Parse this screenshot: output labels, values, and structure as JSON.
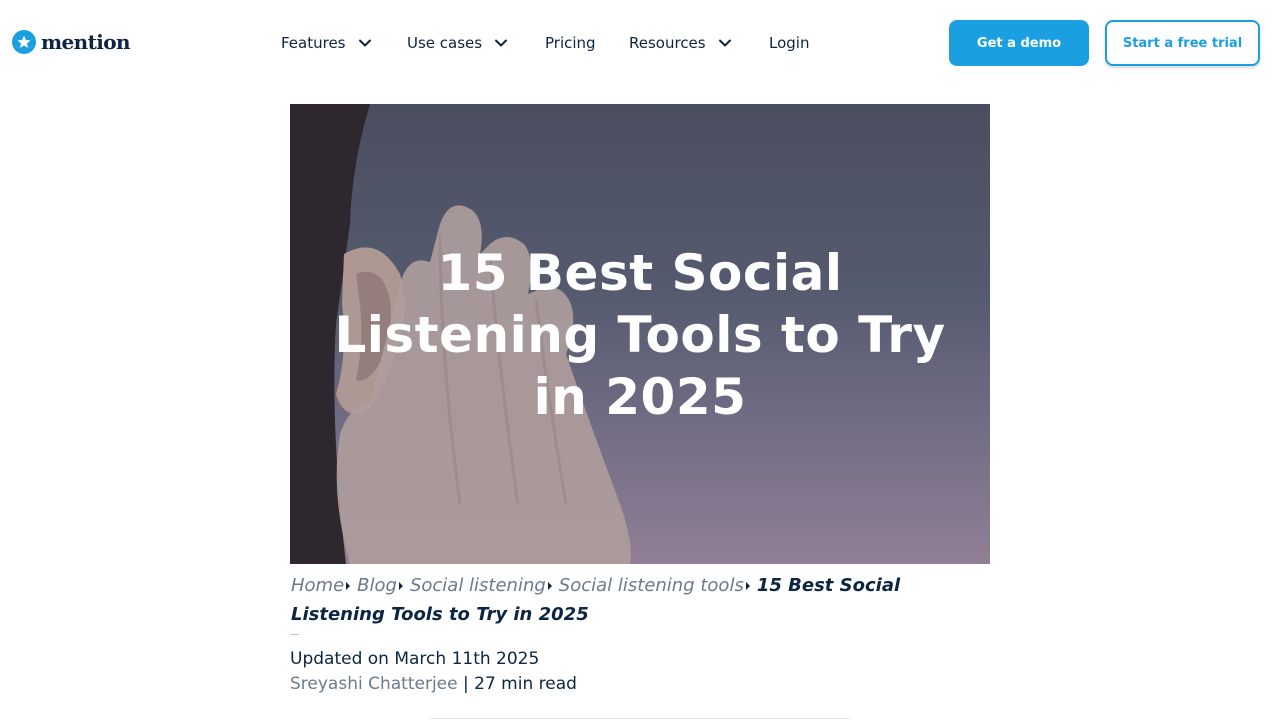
{
  "brand": {
    "name": "mention",
    "logo_icon": "star-icon",
    "accent_color": "#1a9fe0",
    "text_color": "#0b2542"
  },
  "nav": {
    "features": "Features",
    "use_cases": "Use cases",
    "pricing": "Pricing",
    "resources": "Resources",
    "login": "Login"
  },
  "cta": {
    "demo": "Get a demo",
    "trial": "Start a free trial"
  },
  "hero": {
    "title": "15 Best Social Listening Tools to Try in 2025"
  },
  "breadcrumb": {
    "items": [
      "Home",
      "Blog",
      "Social listening",
      "Social listening tools"
    ],
    "current": "15 Best Social Listening Tools to Try in 2025"
  },
  "article": {
    "updated": "Updated on March 11th 2025",
    "author": "Sreyashi Chatterjee",
    "separator": " | ",
    "read_time": "27 min read"
  }
}
